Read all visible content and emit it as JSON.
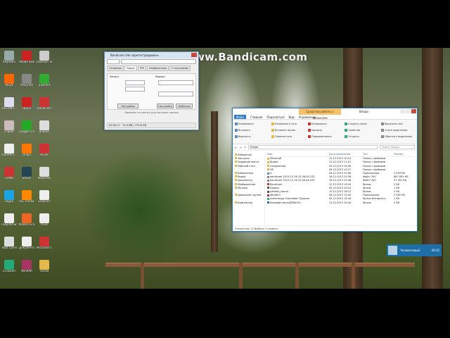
{
  "watermark": "www.Bandicam.com",
  "desktop_icons": [
    {
      "label": "Корзина",
      "color": "#9aa"
    },
    {
      "label": "Avast",
      "color": "#f60"
    },
    {
      "label": "2913685...",
      "color": "#dde"
    },
    {
      "label": "Сервис",
      "color": "#cbb"
    },
    {
      "label": "XiaoHeiX...",
      "color": "#eee"
    },
    {
      "label": "ZONA",
      "color": "#c33"
    },
    {
      "label": "Skype",
      "color": "#1aa3e0"
    },
    {
      "label": "Подключиться",
      "color": "#eee"
    },
    {
      "label": "Total Commander",
      "color": "#ddd"
    },
    {
      "label": "CCleaner",
      "color": "#2a7"
    },
    {
      "label": "Adobe Reader XI",
      "color": "#c22"
    },
    {
      "label": "Proxy ИХ",
      "color": "#888"
    },
    {
      "label": "Opera",
      "color": "#c22"
    },
    {
      "label": "Google Chrome",
      "color": "#2a2"
    },
    {
      "label": "Origin",
      "color": "#f70"
    },
    {
      "label": "Steam",
      "color": "#245"
    },
    {
      "label": "VLC media player",
      "color": "#f80"
    },
    {
      "label": "Mozilla Firefox",
      "color": "#e62"
    },
    {
      "label": "Документы",
      "color": "#eee"
    },
    {
      "label": "WinRAR",
      "color": "#a36"
    },
    {
      "label": "Daemon Tools",
      "color": "#ccc"
    },
    {
      "label": "uTorrent",
      "color": "#3a3"
    },
    {
      "label": "Bandicam",
      "color": "#c33"
    },
    {
      "label": "Яндекс",
      "color": "#ddd"
    },
    {
      "label": "K-Lite",
      "color": "#c33"
    },
    {
      "label": "Кошелёк",
      "color": "#ddd"
    },
    {
      "label": "Блокнот",
      "color": "#eee"
    },
    {
      "label": "Paint",
      "color": "#eee"
    },
    {
      "label": "Microsoft Office",
      "color": "#c33"
    },
    {
      "label": "Папка",
      "color": "#e6b84a"
    }
  ],
  "bandicam": {
    "title": "Bandicam (Не зарегистрированн...",
    "tabs": [
      "Основные",
      "Видео",
      "FPS",
      "Изображения",
      "О программе"
    ],
    "tab_selected": "Видео",
    "record_label": "Запись",
    "format_label": "Формат",
    "buttons": [
      "Настройки",
      "Настройки",
      "Шаблоны"
    ],
    "status": "00:00:17 · 74.9 MB / 770.6 GB",
    "status_hint": "Нажмите на кнопку для настроек записи"
  },
  "explorer": {
    "context_tab": "Средства работы с ярлыками",
    "title": "Владо",
    "menu": [
      "Файл",
      "Главная",
      "Поделиться",
      "Вид",
      "Управление"
    ],
    "ribbon_buttons": [
      "Копировать",
      "Вставить",
      "Вырезать",
      "Копировать путь",
      "Вставить ярлык",
      "Переместить",
      "Копировать",
      "Удалить",
      "Переименовать",
      "Создать папку",
      "Свойства",
      "Открыть",
      "Выделить всё",
      "Снять выделение",
      "Обратить выделение"
    ],
    "address": "Владо",
    "search_placeholder": "Поиск: Владо",
    "nav": [
      "Избранное",
      "Загрузки",
      "Недавние места",
      "Рабочий стол",
      "",
      "Библиотеки",
      "Видео",
      "Документы",
      "Изображения",
      "Музыка",
      "",
      "Домашняя группа",
      "",
      "Компьютер"
    ],
    "columns": [
      "Имя",
      "Дата изменения",
      "Тип",
      "Размер"
    ],
    "files": [
      {
        "name": "Minecraft",
        "date": "12.12.2013 10:14",
        "type": "Папка с файлами",
        "size": "",
        "color": "#e6b84a"
      },
      {
        "name": "Видео",
        "date": "12.12.2013 11:01",
        "type": "Папка с файлами",
        "size": "",
        "color": "#e6b84a"
      },
      {
        "name": "Сохранения",
        "date": "05.12.2013 10:26",
        "type": "Папка с файлами",
        "size": "",
        "color": "#e6b84a"
      },
      {
        "name": "НЕ",
        "date": "06.12.2013 10:27",
        "type": "Папка с файлами",
        "size": "",
        "color": "#e6b84a"
      },
      {
        "name": "4",
        "date": "26.12.2013 23:06",
        "type": "Приложение",
        "size": "2 929 КБ",
        "color": "#5a8ac0"
      },
      {
        "name": "bandicam 2013-12-16 15-38-00-232",
        "date": "16.12.2013 15:38",
        "type": "Файл \"AVI\"",
        "size": "887 855 КБ",
        "color": "#888"
      },
      {
        "name": "bandicam 2013-12-16 15-48-44-432",
        "date": "16.12.2013 15:48",
        "type": "Файл \"AVI\"",
        "size": "97 901 КБ",
        "color": "#888"
      },
      {
        "name": "Bandicam",
        "date": "12.12.2013 19:54",
        "type": "Ярлык",
        "size": "2 КБ",
        "color": "#c33"
      },
      {
        "name": "Dragon",
        "date": "05.12.2013 20:14",
        "type": "Ярлык",
        "size": "1 КБ",
        "color": "#555"
      },
      {
        "name": "patrolip_sound",
        "date": "15.12.2013 18:12",
        "type": "Ярлык",
        "size": "2 КБ",
        "color": "#555"
      },
      {
        "name": "WinRar3",
        "date": "06.12.2013 12:45",
        "type": "Приложение",
        "size": "2 952 КБ",
        "color": "#a36"
      },
      {
        "name": "Александр Сергеевич Пушкин",
        "date": "02.12.2013 14:44",
        "type": "Ярлык Интернета",
        "size": "1 КБ",
        "color": "#3a7"
      },
      {
        "name": "Игровой центр@Mail.Ru",
        "date": "12.12.2013 19:44",
        "type": "Ярлык",
        "size": "2 КБ",
        "color": "#36a"
      }
    ],
    "status": "Элементов: 13    Выбран 1 элемент"
  },
  "notification": {
    "name": "Человечевый",
    "time": "40:32"
  }
}
